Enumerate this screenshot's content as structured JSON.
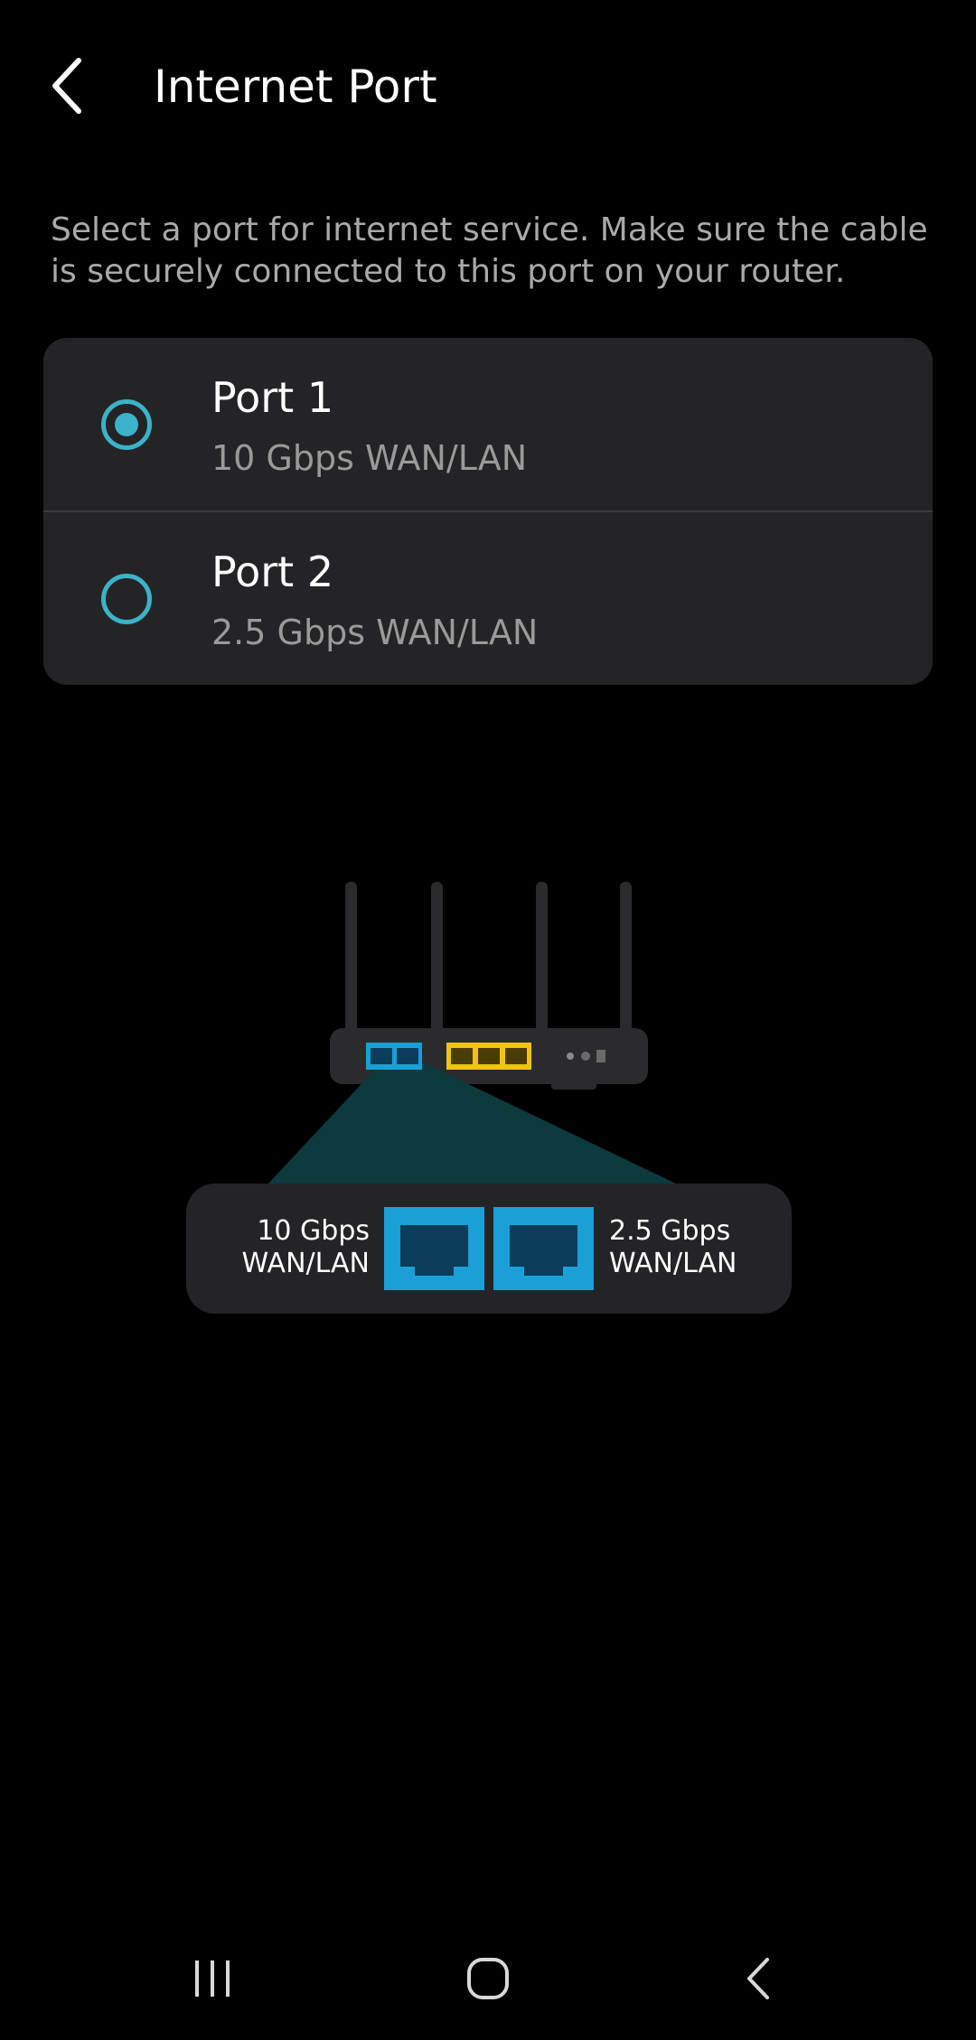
{
  "header": {
    "title": "Internet Port",
    "back_icon": "chevron-left-icon"
  },
  "description": "Select a port for internet service. Make sure the cable is securely connected to this port on your router.",
  "ports": [
    {
      "name": "Port 1",
      "speed": "10 Gbps WAN/LAN",
      "selected": true
    },
    {
      "name": "Port 2",
      "speed": "2.5 Gbps WAN/LAN",
      "selected": false
    }
  ],
  "illustration": {
    "left_label_line1": "10 Gbps",
    "left_label_line2": "WAN/LAN",
    "right_label_line1": "2.5 Gbps",
    "right_label_line2": "WAN/LAN"
  },
  "nav_bar": {
    "recents_icon": "recents-icon",
    "home_icon": "home-icon",
    "back_icon": "back-icon"
  },
  "colors": {
    "background": "#000000",
    "card": "#242426",
    "accent": "#3bb3c8",
    "port_blue": "#1a9fd6",
    "port_yellow": "#f2c313",
    "highlight": "#0c3a3d",
    "secondary_text": "#9a9a9a"
  }
}
